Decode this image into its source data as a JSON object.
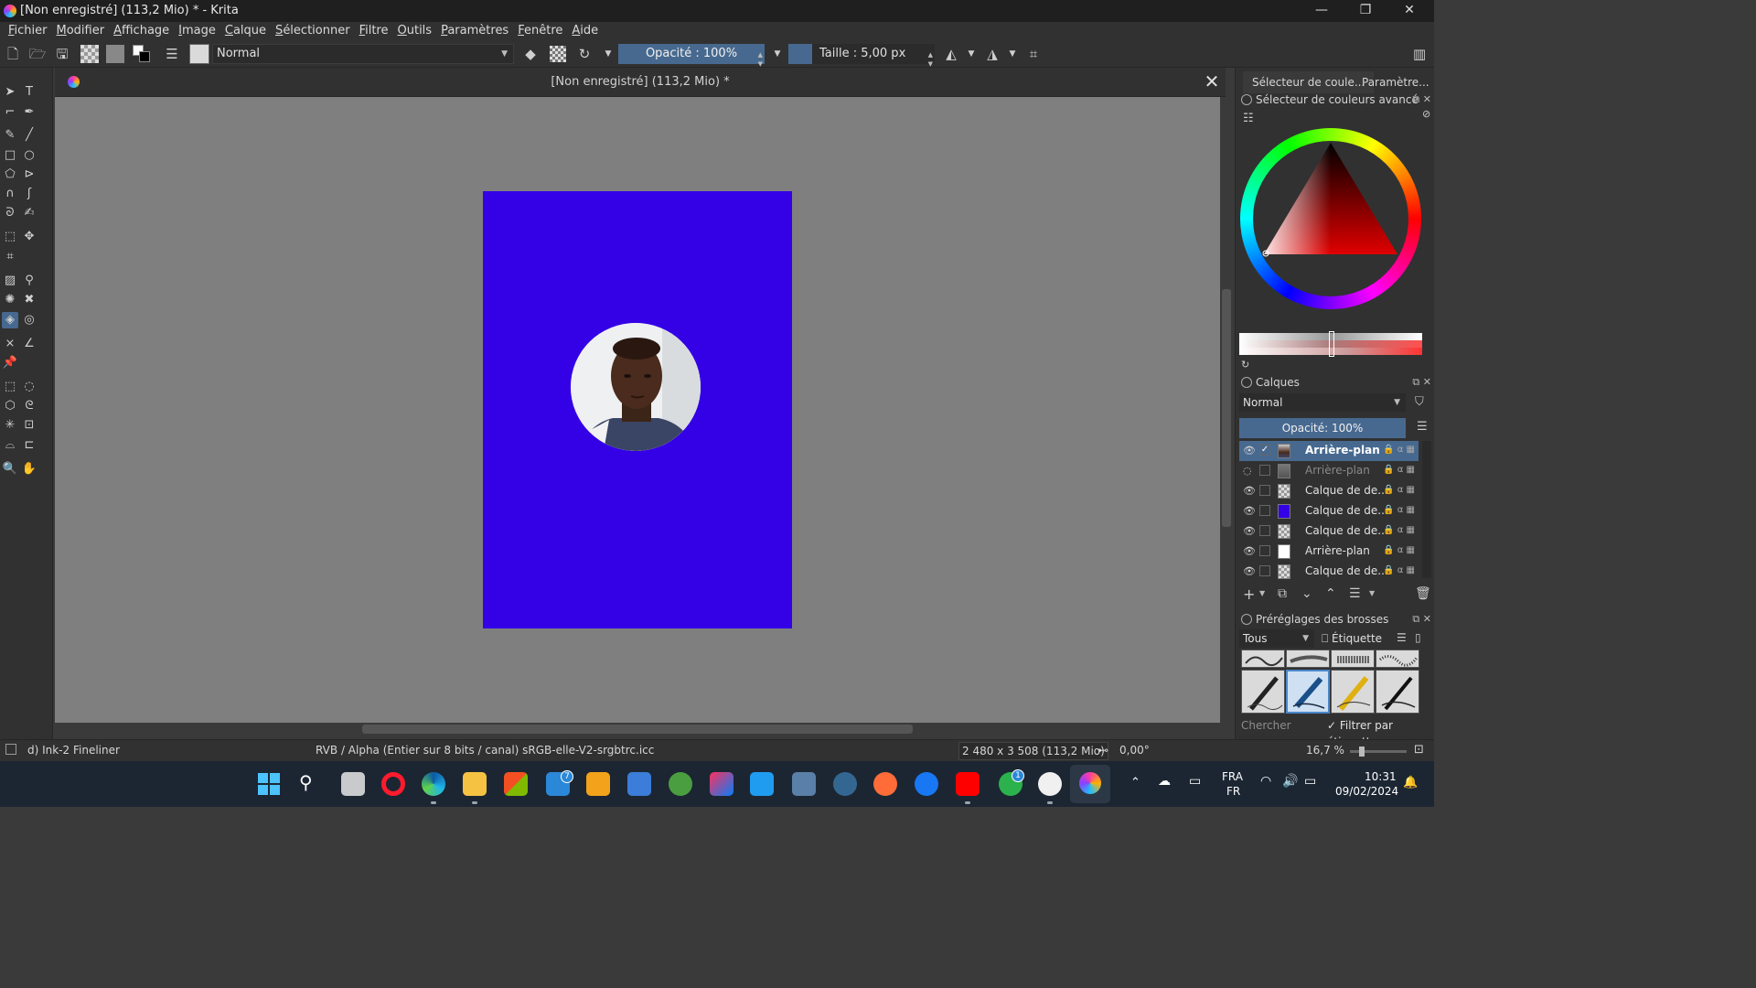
{
  "window": {
    "title": "[Non enregistré]  (113,2 Mio) * - Krita",
    "minimize": "—",
    "maximize": "❐",
    "close": "✕"
  },
  "menu": [
    "Fichier",
    "Modifier",
    "Affichage",
    "Image",
    "Calque",
    "Sélectionner",
    "Filtre",
    "Outils",
    "Paramètres",
    "Fenêtre",
    "Aide"
  ],
  "toolbar": {
    "blend_mode": "Normal",
    "opacity": "Opacité : 100%",
    "size": "Taille :  5,00 px"
  },
  "document": {
    "tab_title": "[Non enregistré]  (113,2 Mio) *",
    "page_color": "#3400e6"
  },
  "dock": {
    "tabs": [
      "Sélecteur de coule...",
      "Paramètre..."
    ],
    "color_selector_title": "Sélecteur de couleurs avancé",
    "layers_title": "Calques",
    "layers_blend": "Normal",
    "layers_opacity": "Opacité:  100%",
    "layers": [
      {
        "name": "Arrière-plan",
        "visible": true,
        "selected": true,
        "thumb": "photo"
      },
      {
        "name": "Arrière-plan",
        "visible": false,
        "selected": false,
        "thumb": "photo-dim"
      },
      {
        "name": "Calque de de...",
        "visible": true,
        "selected": false,
        "thumb": "transparent"
      },
      {
        "name": "Calque de de...",
        "visible": true,
        "selected": false,
        "thumb": "blue"
      },
      {
        "name": "Calque de de...",
        "visible": true,
        "selected": false,
        "thumb": "transparent"
      },
      {
        "name": "Arrière-plan",
        "visible": true,
        "selected": false,
        "thumb": "white"
      },
      {
        "name": "Calque de de...",
        "visible": true,
        "selected": false,
        "thumb": "transparent"
      }
    ],
    "brush_presets_title": "Préréglages des brosses",
    "brush_filter": "Tous",
    "brush_tag": "Étiquette",
    "brush_search_placeholder": "Chercher",
    "brush_filter_by_tag": "Filtrer par étiquette"
  },
  "status": {
    "brush_name": "d) Ink-2 Fineliner",
    "color_profile": "RVB / Alpha (Entier sur 8 bits / canal)  sRGB-elle-V2-srgbtrc.icc",
    "dimensions": "2 480 x 3 508 (113,2 Mio)",
    "rotation": "0,00°",
    "zoom": "16,7 %"
  },
  "taskbar": {
    "mail_badge": "7",
    "app_badge": "1",
    "lang_line1": "FRA",
    "lang_line2": "FR",
    "time": "10:31",
    "date": "09/02/2024"
  }
}
